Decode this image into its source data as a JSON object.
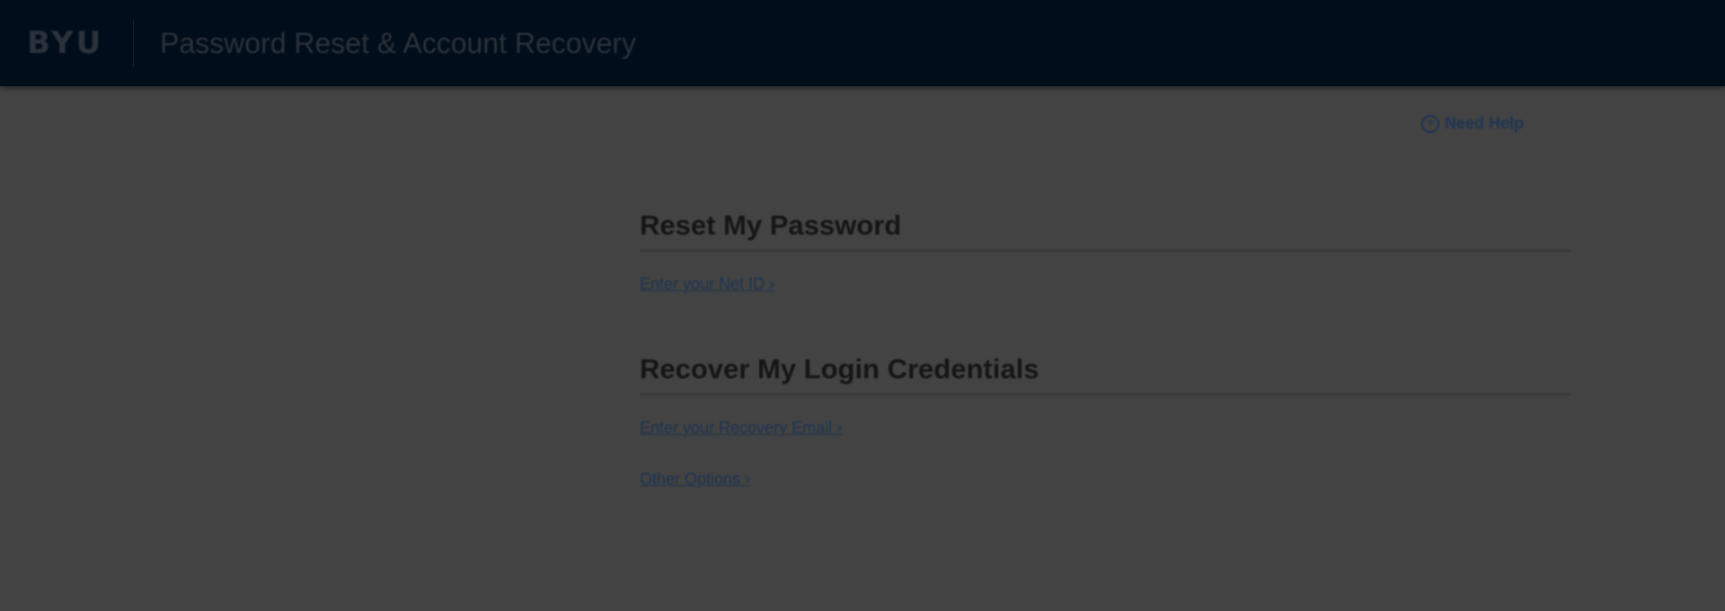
{
  "header": {
    "logo": "BYU",
    "title": "Password Reset & Account Recovery"
  },
  "help": {
    "icon": "question-circle-icon",
    "label": "Need Help"
  },
  "sections": [
    {
      "title": "Reset My Password",
      "links": [
        "Enter your Net ID"
      ]
    },
    {
      "title": "Recover My Login Credentials",
      "links": [
        "Enter your Recovery Email",
        "Other Options"
      ]
    }
  ],
  "colors": {
    "header_bg": "#020d1b",
    "page_bg": "#434343",
    "link": "#1d3450"
  }
}
